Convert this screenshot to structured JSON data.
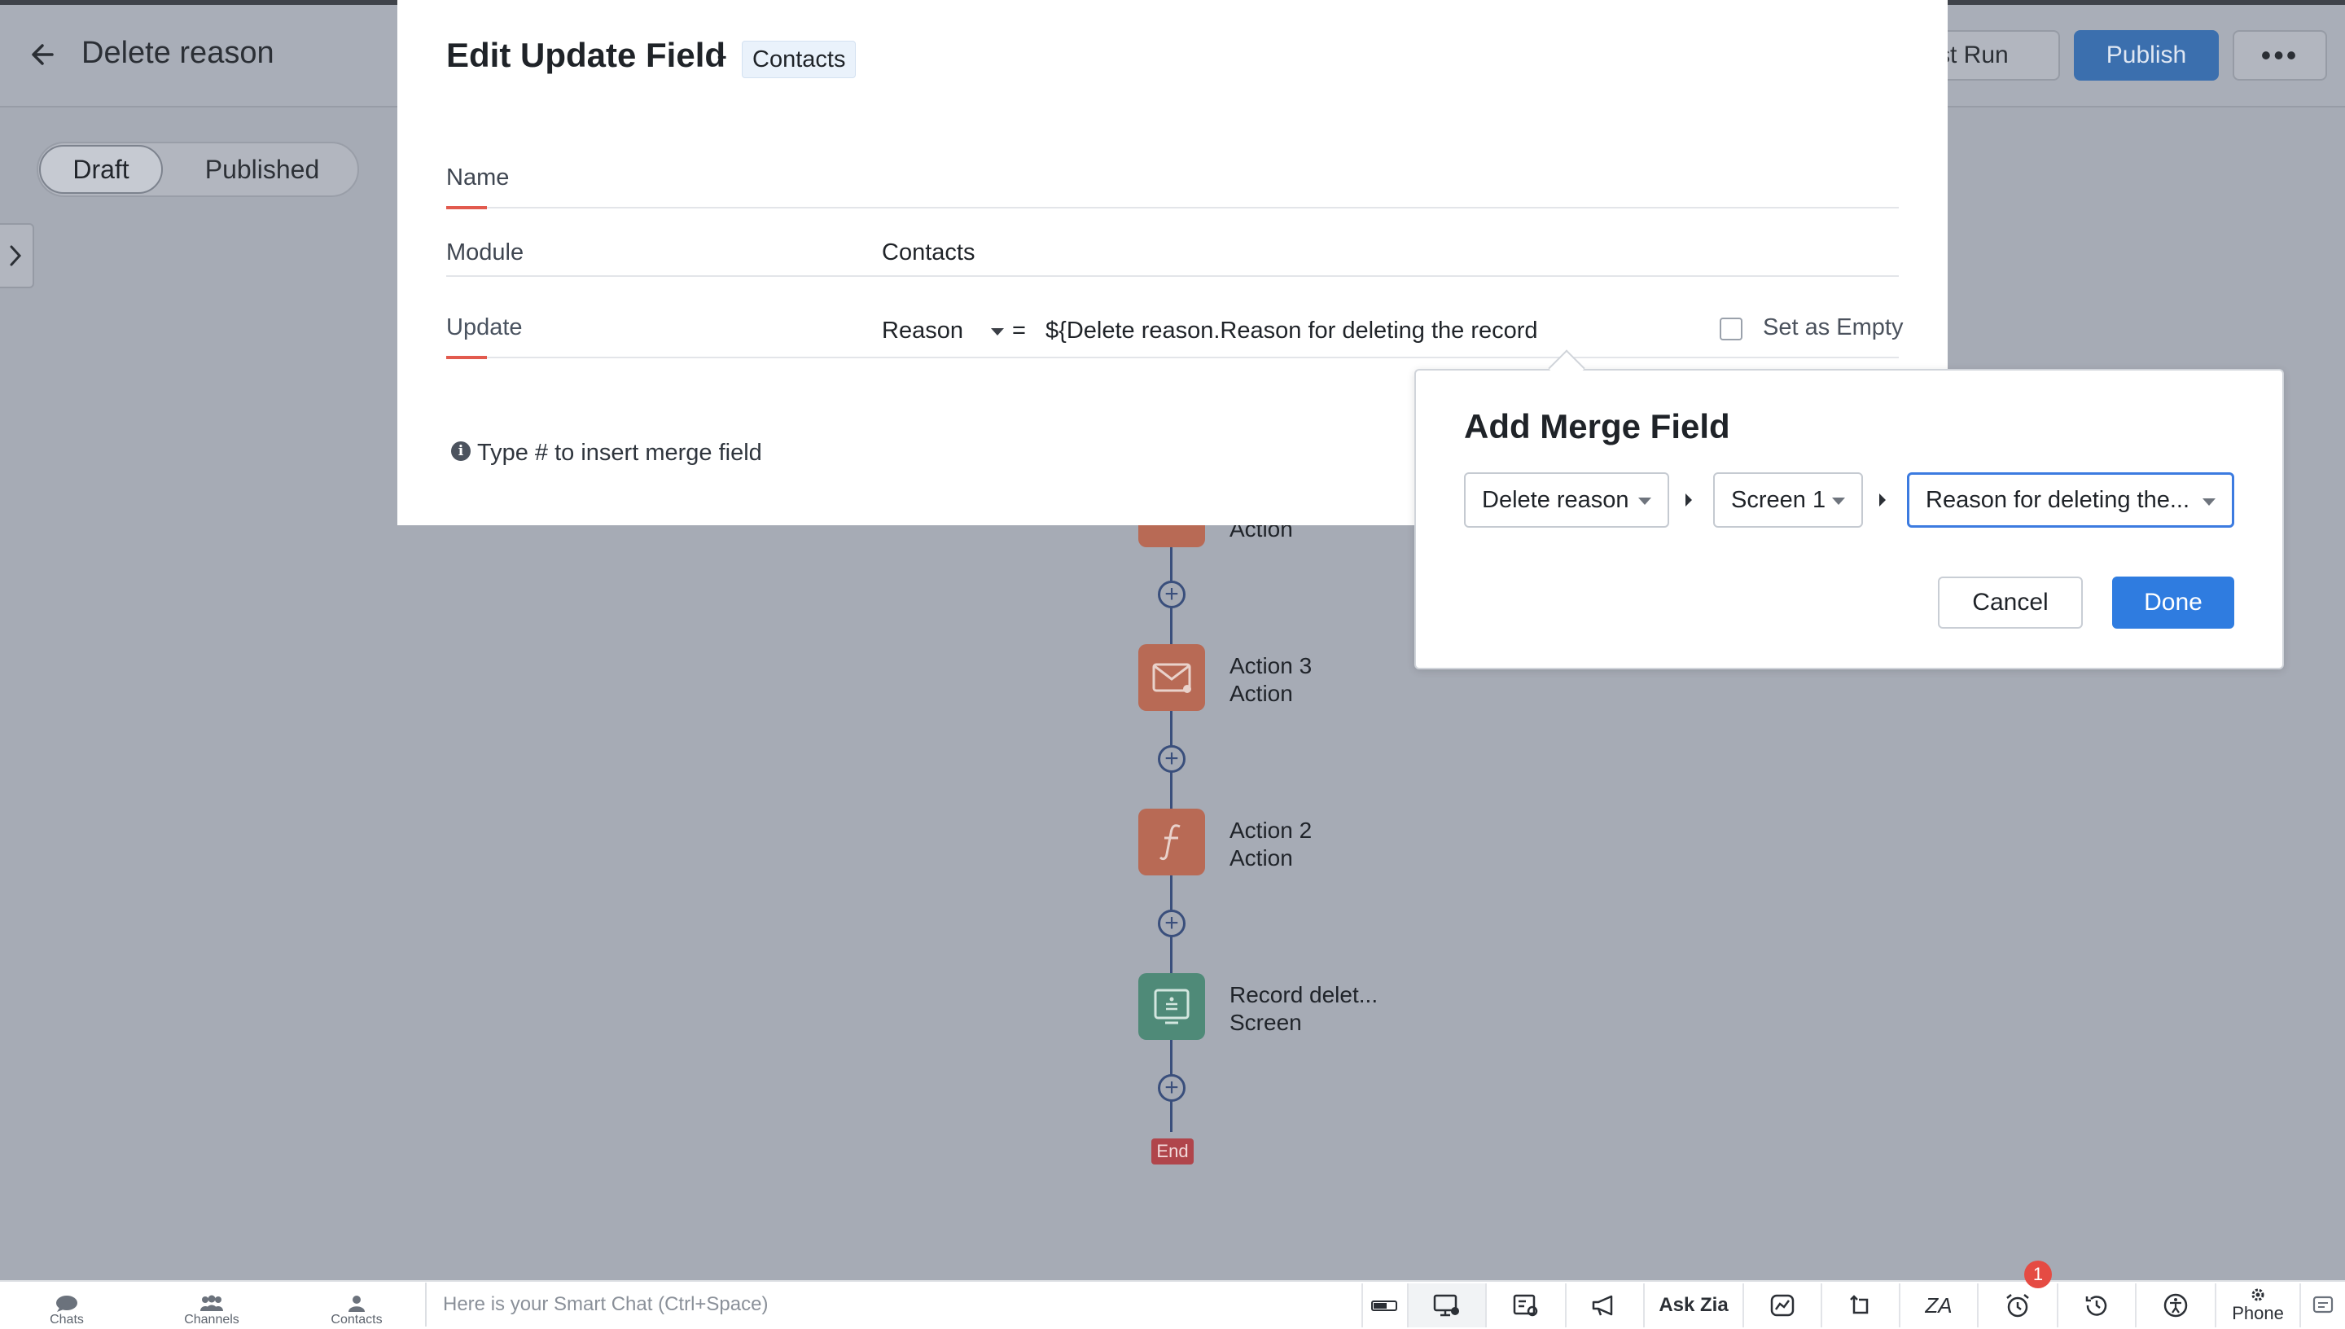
{
  "header": {
    "title": "Delete reason",
    "test_run_label": "est Run",
    "publish_label": "Publish",
    "more_label": "•••"
  },
  "toggle": {
    "draft_label": "Draft",
    "published_label": "Published"
  },
  "flow": {
    "nodes": [
      {
        "title": "",
        "subtitle": "Action",
        "icon": "action-icon"
      },
      {
        "title": "Action 3",
        "subtitle": "Action",
        "icon": "mail-icon"
      },
      {
        "title": "Action 2",
        "subtitle": "Action",
        "icon": "function-icon"
      },
      {
        "title": "Record delet...",
        "subtitle": "Screen",
        "icon": "screen-icon"
      }
    ],
    "end_label": "End"
  },
  "modal": {
    "title": "Edit Update Field",
    "dash": "-",
    "module_chip": "Contacts",
    "fields": {
      "name_label": "Name",
      "module_label": "Module",
      "module_value": "Contacts",
      "update_label": "Update",
      "update_field": "Reason",
      "equals": "=",
      "update_expression": "${Delete reason.Reason for deleting the record",
      "set_empty_label": "Set as Empty"
    },
    "hint": "Type # to insert merge field"
  },
  "merge_popup": {
    "title": "Add Merge Field",
    "select1": "Delete reason",
    "select2": "Screen 1",
    "select3": "Reason for deleting the...",
    "cancel_label": "Cancel",
    "done_label": "Done"
  },
  "bottom_bar": {
    "chats": "Chats",
    "channels": "Channels",
    "contacts": "Contacts",
    "smart_chat_placeholder": "Here is your Smart Chat (Ctrl+Space)",
    "ask_zia": "Ask Zia",
    "phone": "Phone",
    "notification_count": "1"
  },
  "colors": {
    "accent": "#2f7ce0",
    "publish": "#3b6fae",
    "required_underline": "#e25a4e",
    "node_orange": "#b86a55",
    "node_green": "#4f8a78",
    "end_tag": "#b0454b",
    "badge": "#e54b43"
  }
}
